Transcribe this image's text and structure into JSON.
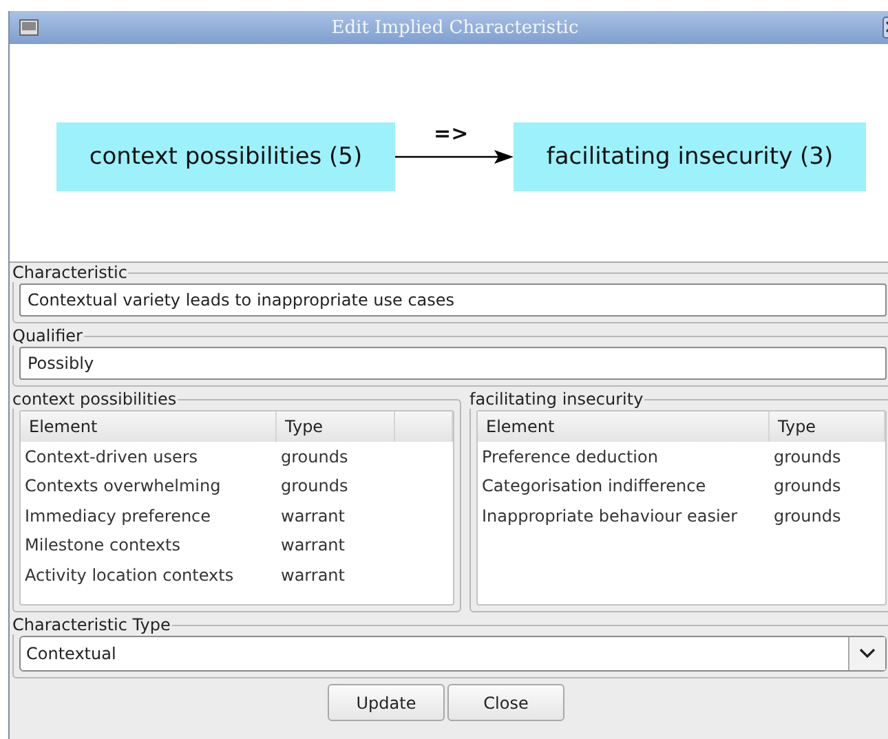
{
  "window": {
    "title": "Edit Implied Characteristic"
  },
  "diagram": {
    "source": {
      "label": "context possibilities (5)"
    },
    "target": {
      "label": "facilitating insecurity (3)"
    },
    "edge_label": "=>"
  },
  "characteristic": {
    "label": "Characteristic",
    "value": "Contextual variety leads to inappropriate use cases"
  },
  "qualifier": {
    "label": "Qualifier",
    "value": "Possibly"
  },
  "panels": [
    {
      "title": "context possibilities",
      "columns": [
        "Element",
        "Type"
      ],
      "rows": [
        {
          "element": "Context-driven users",
          "type": "grounds"
        },
        {
          "element": "Contexts overwhelming",
          "type": "grounds"
        },
        {
          "element": "Immediacy preference",
          "type": "warrant"
        },
        {
          "element": "Milestone contexts",
          "type": "warrant"
        },
        {
          "element": "Activity location contexts",
          "type": "warrant"
        }
      ]
    },
    {
      "title": "facilitating insecurity",
      "columns": [
        "Element",
        "Type"
      ],
      "rows": [
        {
          "element": "Preference deduction",
          "type": "grounds"
        },
        {
          "element": "Categorisation indifference",
          "type": "grounds"
        },
        {
          "element": "Inappropriate behaviour easier",
          "type": "grounds"
        }
      ]
    }
  ],
  "characteristic_type": {
    "label": "Characteristic Type",
    "value": "Contextual"
  },
  "buttons": [
    "Update",
    "Close"
  ]
}
